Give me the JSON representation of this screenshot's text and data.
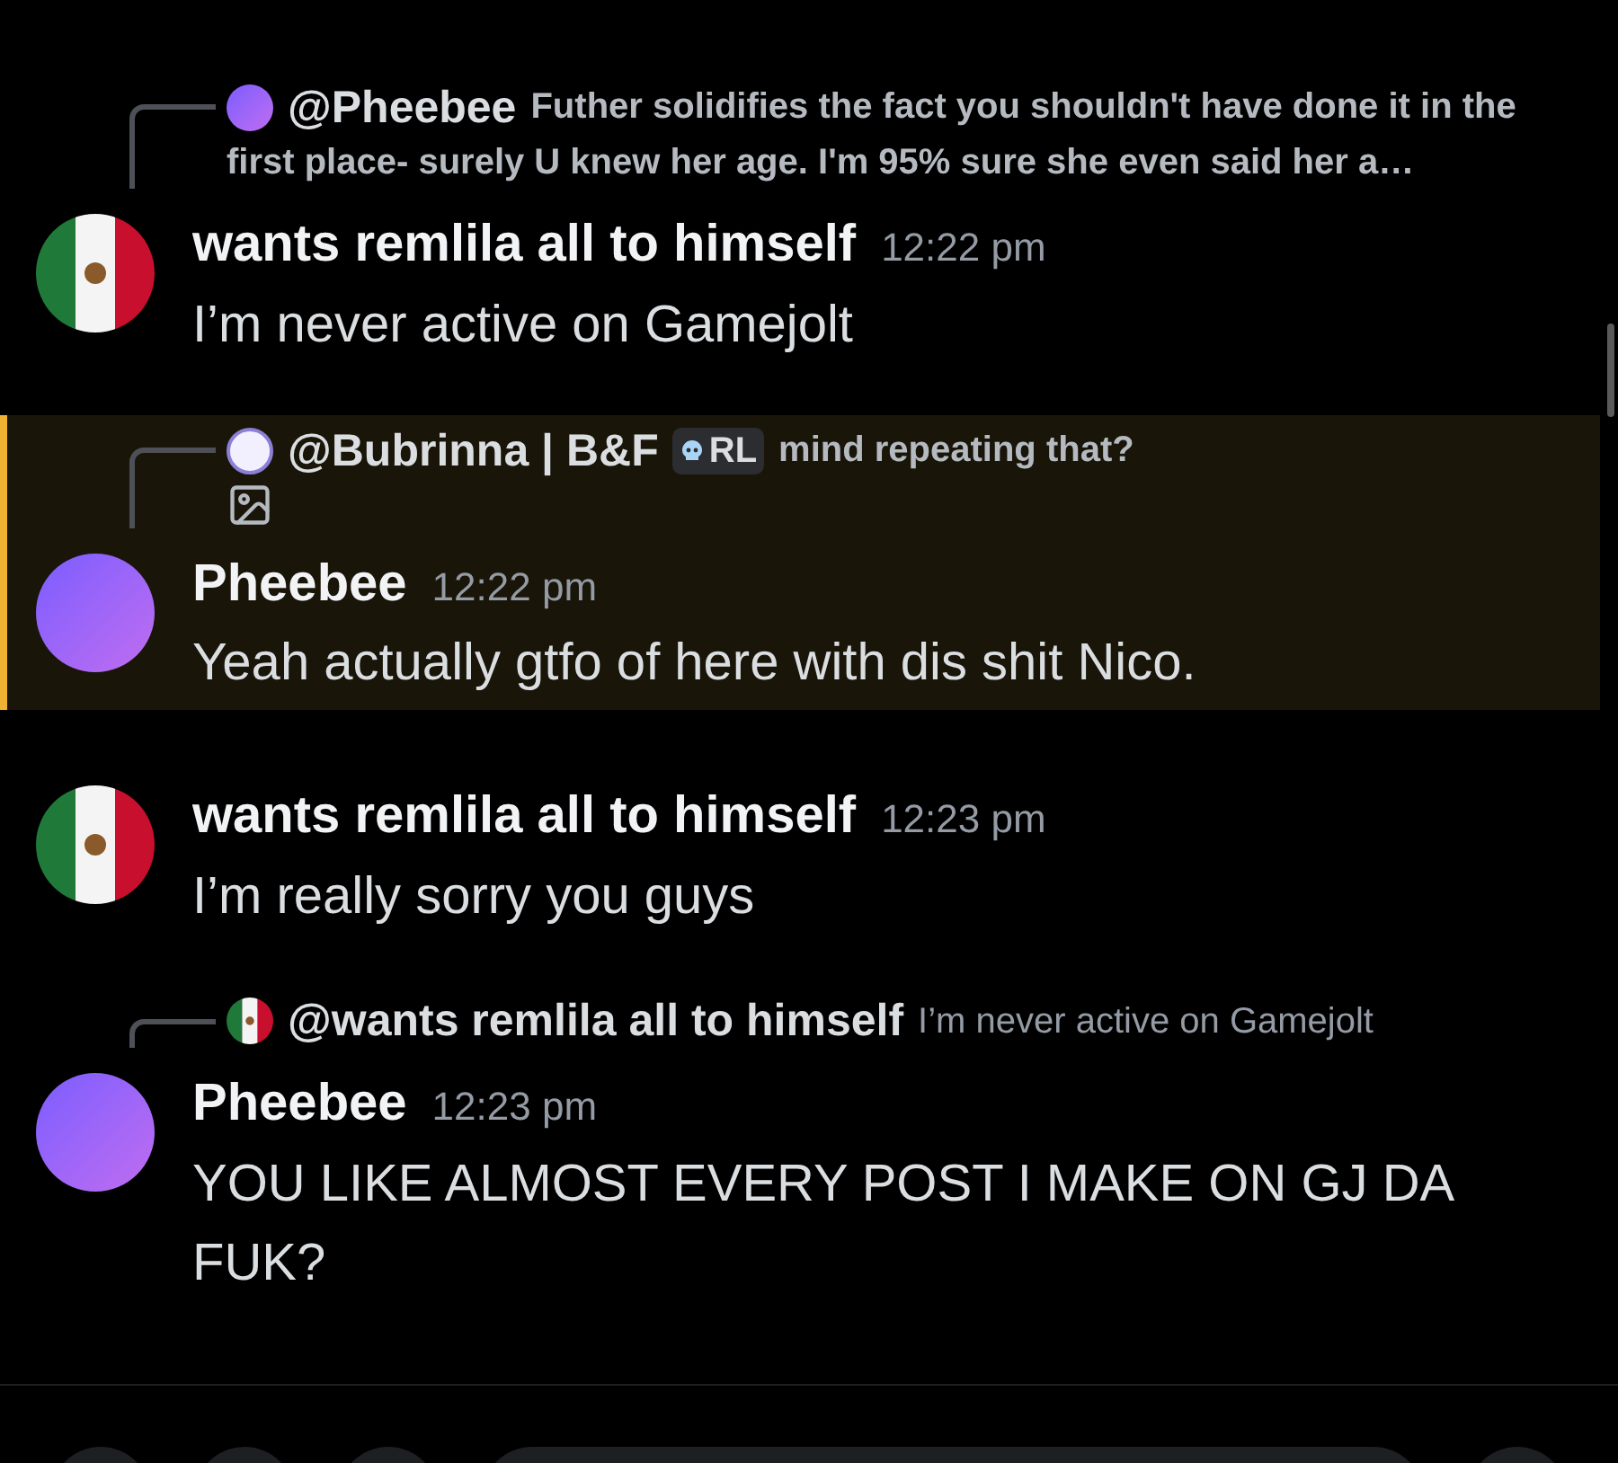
{
  "messages": [
    {
      "reply": {
        "avatar": {
          "kind": "image"
        },
        "author": "@Pheebee",
        "text": "Futher solidifies the fact you shouldn't have done it in the first place- surely U knew her age. I'm 95% sure she even said her a…",
        "bold_text": true
      },
      "avatar": {
        "kind": "flag"
      },
      "author": "wants remlila all to himself",
      "time": "12:22 pm",
      "text": "I’m never active on Gamejolt",
      "highlighted": false
    },
    {
      "reply": {
        "avatar": {
          "kind": "outline"
        },
        "author": "@Bubrinna | B&F",
        "tag": "RL",
        "text": "mind repeating that?",
        "bold_text": true,
        "attachment": true
      },
      "avatar": {
        "kind": "image"
      },
      "author": "Pheebee",
      "time": "12:22 pm",
      "text": "Yeah actually gtfo of here with dis shit Nico.",
      "highlighted": true
    },
    {
      "avatar": {
        "kind": "flag"
      },
      "author": "wants remlila all to himself",
      "time": "12:23 pm",
      "text": "I’m really sorry you guys",
      "highlighted": false
    },
    {
      "reply": {
        "avatar": {
          "kind": "flag"
        },
        "author": "@wants remlila all to himself",
        "text": "I’m never active on Gamejolt",
        "bold_text": false
      },
      "avatar": {
        "kind": "image"
      },
      "author": "Pheebee",
      "time": "12:23 pm",
      "text": "YOU LIKE ALMOST EVERY POST I MAKE ON GJ DA FUK?",
      "highlighted": false
    }
  ]
}
